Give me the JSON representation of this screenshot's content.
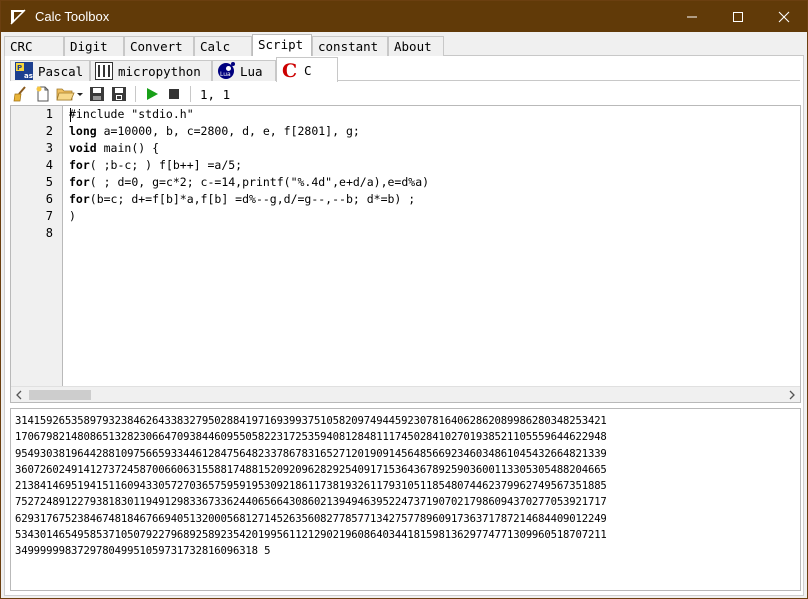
{
  "window": {
    "title": "Calc Toolbox"
  },
  "main_tabs": [
    {
      "label": "CRC"
    },
    {
      "label": "Digit"
    },
    {
      "label": "Convert"
    },
    {
      "label": "Calc"
    },
    {
      "label": "Script"
    },
    {
      "label": "constant"
    },
    {
      "label": "About"
    }
  ],
  "script_tabs": [
    {
      "label": "Pascal",
      "icon": "pascal-icon"
    },
    {
      "label": "micropython",
      "icon": "micropython-icon"
    },
    {
      "label": "Lua",
      "icon": "lua-icon"
    },
    {
      "label": "C",
      "icon": "c-language-icon"
    }
  ],
  "toolbar": {
    "cursor_position": "1, 1"
  },
  "editor": {
    "line_numbers": [
      "1",
      "2",
      "3",
      "4",
      "5",
      "6",
      "7",
      "8"
    ],
    "lines": [
      [
        {
          "t": "#include \"stdio.h\"",
          "k": false
        }
      ],
      [
        {
          "t": "long",
          "k": true
        },
        {
          "t": " a=10000, b, c=2800, d, e, f[2801], g;",
          "k": false
        }
      ],
      [
        {
          "t": "void",
          "k": true
        },
        {
          "t": " main() {",
          "k": false
        }
      ],
      [
        {
          "t": "for",
          "k": true
        },
        {
          "t": "( ;b-c; ) f[b++] =a/5;",
          "k": false
        }
      ],
      [
        {
          "t": "for",
          "k": true
        },
        {
          "t": "( ; d=0, g=c*2; c-=14,printf(\"%.4d\",e+d/a),e=d%a)",
          "k": false
        }
      ],
      [
        {
          "t": "for",
          "k": true
        },
        {
          "t": "(b=c; d+=f[b]*a,f[b] =d%--g,d/=g--,--b; d*=b) ;",
          "k": false
        }
      ],
      [
        {
          "t": ")",
          "k": false
        }
      ],
      [
        {
          "t": "",
          "k": false
        }
      ]
    ]
  },
  "output": {
    "lines": [
      "31415926535897932384626433832795028841971693993751058209749445923078164062862089986280348253421",
      "17067982148086513282306647093844609550582231725359408128481117450284102701938521105559644622948",
      "95493038196442881097566593344612847564823378678316527120190914564856692346034861045432664821339",
      "36072602491412737245870066063155881748815209209628292540917153643678925903600113305305488204665",
      "21384146951941511609433057270365759591953092186117381932611793105118548074462379962749567351885",
      "75272489122793818301194912983367336244065664308602139494639522473719070217986094370277053921717",
      "62931767523846748184676694051320005681271452635608277857713427577896091736371787214684409012249",
      "53430146549585371050792279689258923542019956112129021960864034418159813629774771309960518707211",
      "349999998372978049951059731732816096318 5"
    ]
  }
}
